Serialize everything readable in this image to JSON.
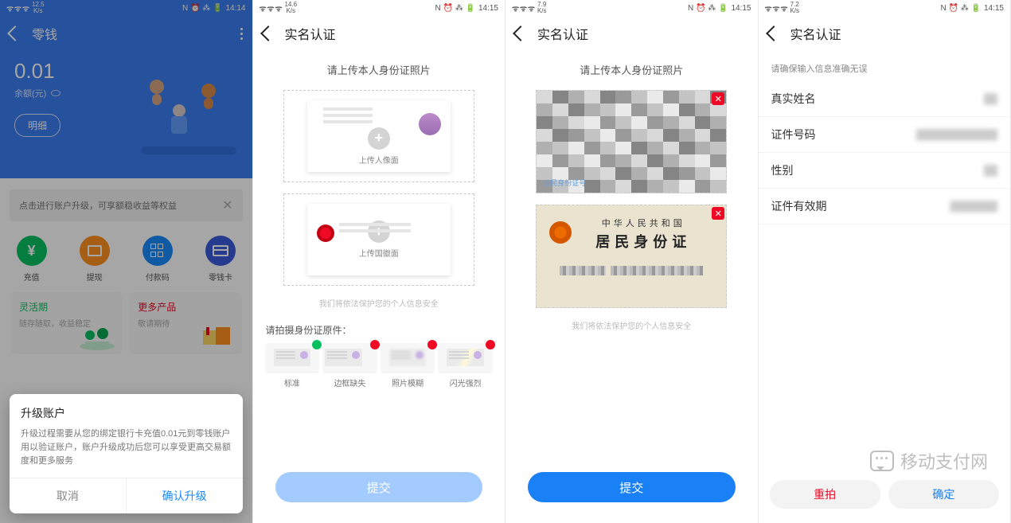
{
  "statusbars": [
    {
      "speed": "12.5",
      "speed_unit": "K/s",
      "time": "14:14",
      "icons": "N ⏰ ⁂ 🔋"
    },
    {
      "speed": "14.6",
      "speed_unit": "K/s",
      "time": "14:15",
      "icons": "N ⏰ ⁂ 🔋"
    },
    {
      "speed": "7.9",
      "speed_unit": "K/s",
      "time": "14:15",
      "icons": "N ⏰ ⁂ 🔋"
    },
    {
      "speed": "7.2",
      "speed_unit": "K/s",
      "time": "14:15",
      "icons": "N ⏰ ⁂ 🔋"
    }
  ],
  "screen1": {
    "title": "零钱",
    "balance": "0.01",
    "balance_label": "余额(元)",
    "detail_btn": "明细",
    "banner": "点击进行账户升级，可享额稳收益等权益",
    "grid": [
      {
        "label": "充值"
      },
      {
        "label": "提现"
      },
      {
        "label": "付款码"
      },
      {
        "label": "零钱卡"
      }
    ],
    "cards": {
      "left_title": "灵活期",
      "left_sub": "随存随取，收益稳定",
      "right_title": "更多产品",
      "right_sub": "敬请期待"
    },
    "dialog": {
      "title": "升级账户",
      "body": "升级过程需要从您的绑定银行卡充值0.01元到零钱账户用以验证账户，账户升级成功后您可以享受更高交易额度和更多服务",
      "cancel": "取消",
      "confirm": "确认升级"
    }
  },
  "screen2": {
    "title": "实名认证",
    "upload_title": "请上传本人身份证照片",
    "front_label": "上传人像面",
    "back_label": "上传国徽面",
    "note": "我们将依法保护您的个人信息安全",
    "guide_title": "请拍摄身份证原件：",
    "guides": [
      "标准",
      "边框缺失",
      "照片模糊",
      "闪光强烈"
    ],
    "submit": "提交"
  },
  "screen3": {
    "title": "实名认证",
    "upload_title": "请上传本人身份证照片",
    "front_corner": "公民身份证号",
    "back_line1": "中华人民共和国",
    "back_line2": "居民身份证",
    "note": "我们将依法保护您的个人信息安全",
    "submit": "提交"
  },
  "screen4": {
    "title": "实名认证",
    "tip": "请确保输入信息准确无误",
    "rows": [
      {
        "label": "真实姓名",
        "value": "██"
      },
      {
        "label": "证件号码",
        "value": "████████████"
      },
      {
        "label": "性别",
        "value": "██"
      },
      {
        "label": "证件有效期",
        "value": "███████"
      }
    ],
    "reshoot": "重拍",
    "confirm": "确定"
  },
  "watermark": "移动支付网"
}
